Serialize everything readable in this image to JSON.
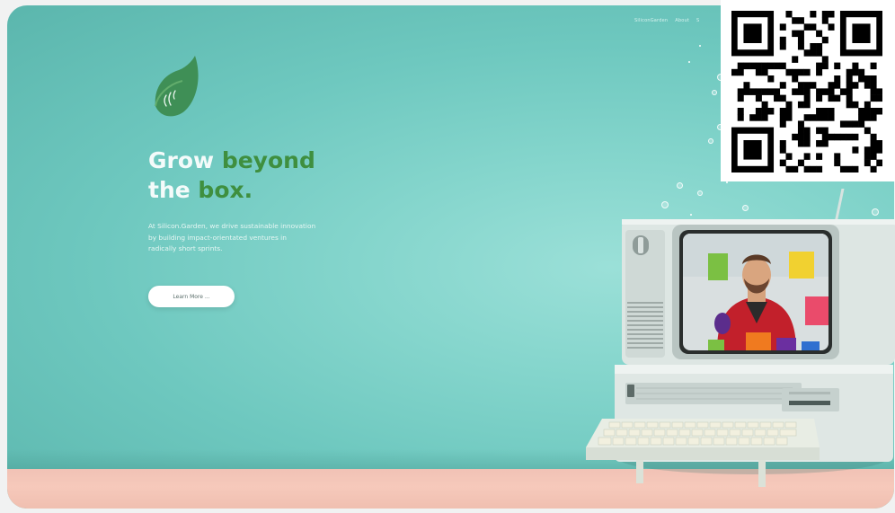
{
  "nav": {
    "items": [
      "SiliconGarden",
      "About",
      "S"
    ]
  },
  "hero": {
    "headline_line1_white": "Grow ",
    "headline_line1_green": "beyond",
    "headline_line2_white": "the ",
    "headline_line2_green": "box.",
    "tagline_lines": [
      "At Silicon.Garden, we drive sustainable innovation",
      "by building impact-orientated ventures in",
      "radically short sprints."
    ],
    "cta_label": "Learn More ..."
  },
  "colors": {
    "accent_green": "#3f8f3f",
    "background_teal": "#84d5cc",
    "floor_peach": "#f6c9bb"
  },
  "icons": {
    "logo": "leaf-logo-icon",
    "qr": "qr-code-icon"
  }
}
